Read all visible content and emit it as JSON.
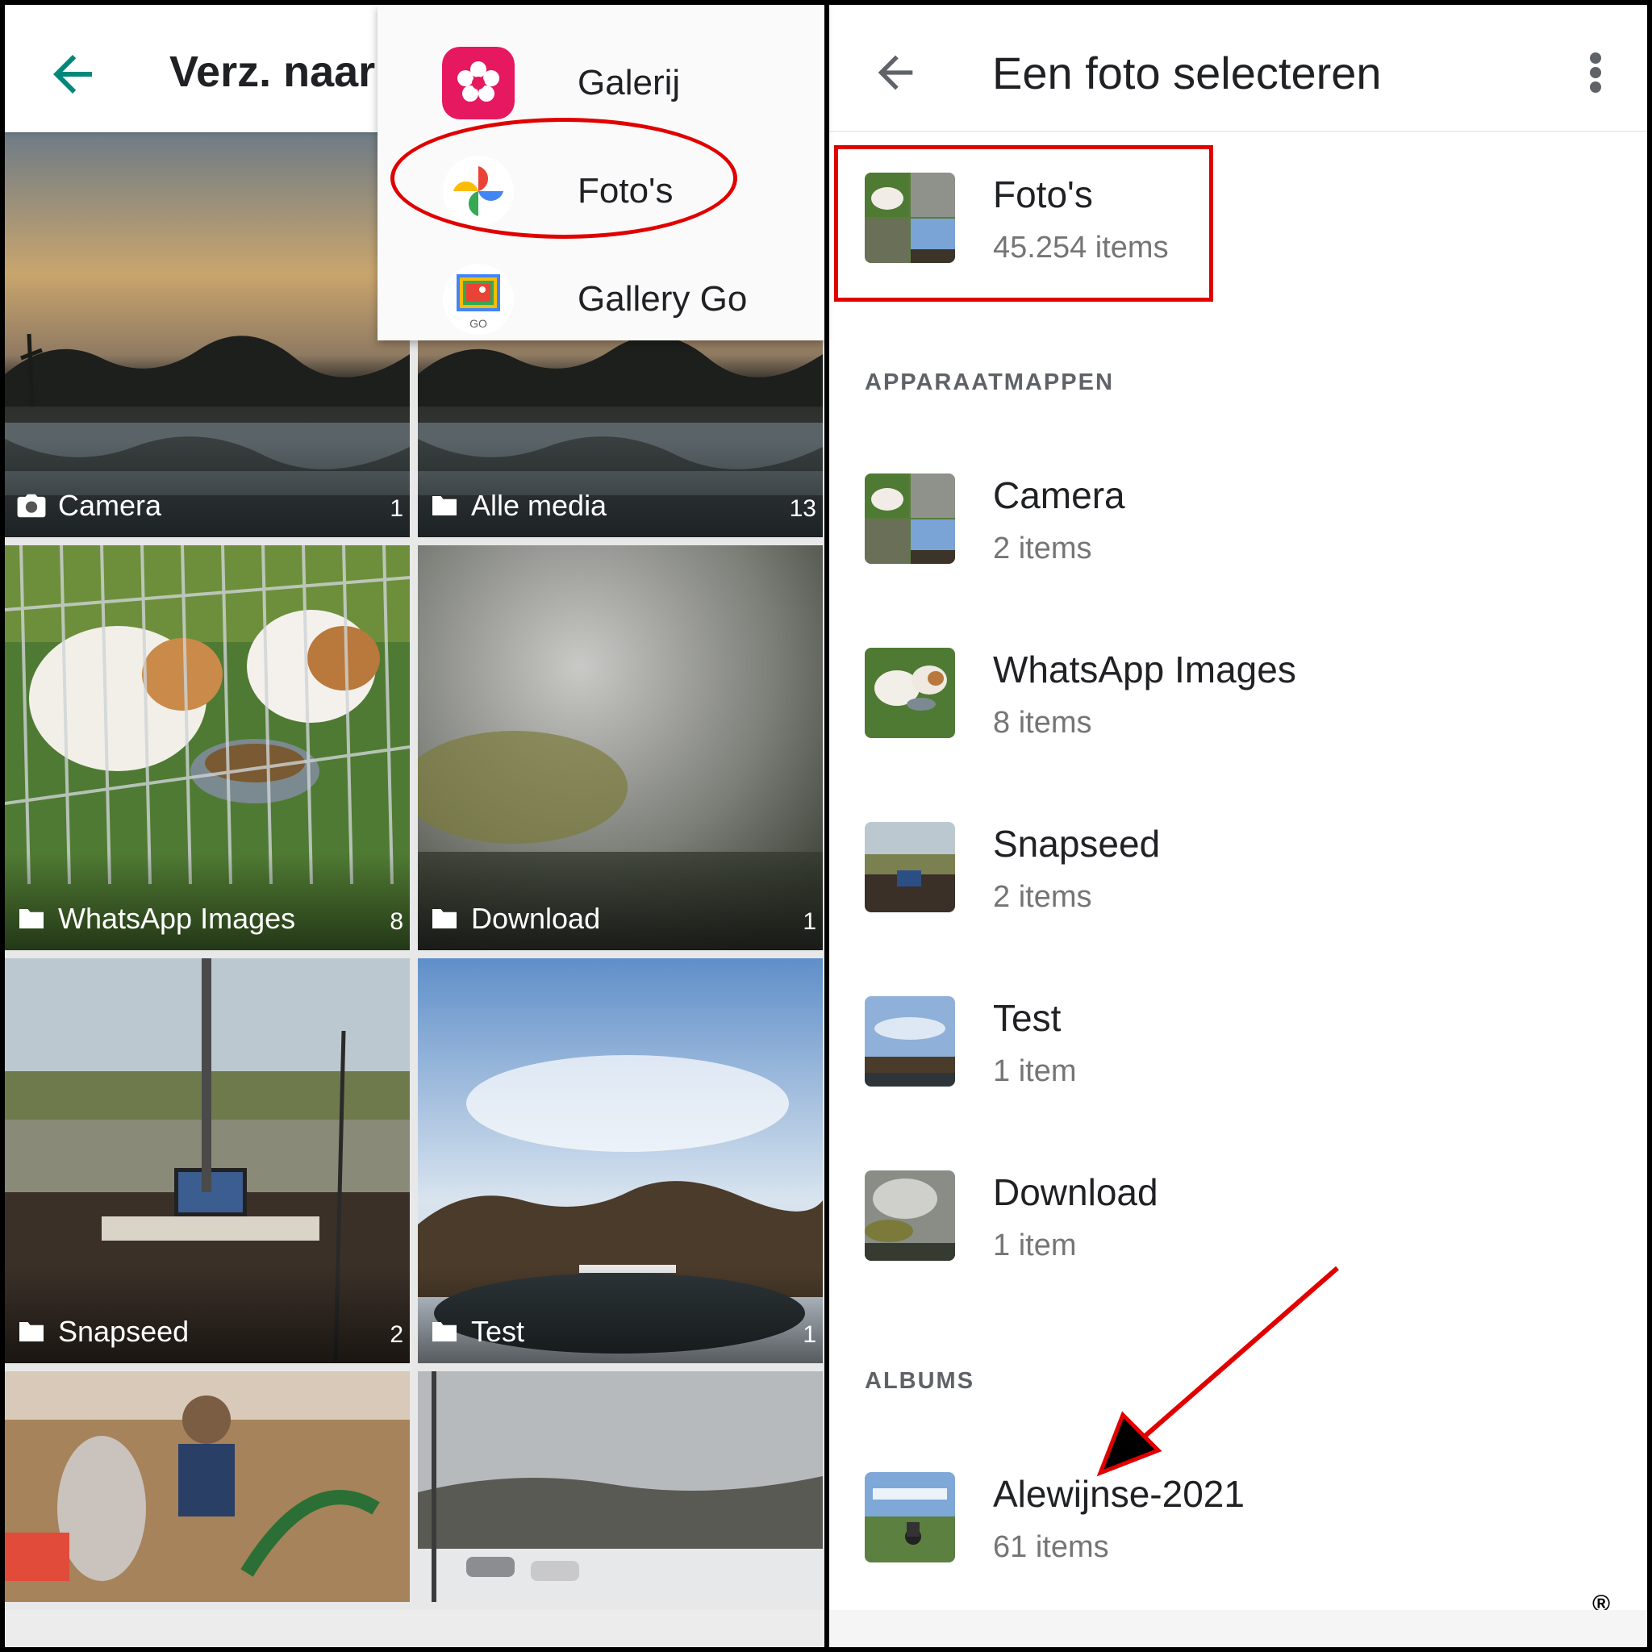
{
  "left": {
    "title": "Verz. naar",
    "tiles": [
      {
        "label": "Camera",
        "count": "1",
        "icon": "camera-icon"
      },
      {
        "label": "Alle media",
        "count": "13",
        "icon": "folder-icon"
      },
      {
        "label": "WhatsApp Images",
        "count": "8",
        "icon": "folder-icon"
      },
      {
        "label": "Download",
        "count": "1",
        "icon": "folder-icon"
      },
      {
        "label": "Snapseed",
        "count": "2",
        "icon": "folder-icon"
      },
      {
        "label": "Test",
        "count": "1",
        "icon": "folder-icon"
      }
    ],
    "menu": [
      {
        "label": "Galerij",
        "icon": "galerij-app-icon"
      },
      {
        "label": "Foto's",
        "icon": "google-photos-icon"
      },
      {
        "label": "Gallery Go",
        "icon": "gallery-go-icon",
        "badge": "GO"
      }
    ]
  },
  "right": {
    "title": "Een foto selecteren",
    "top_item": {
      "name": "Foto's",
      "sub": "45.254 items"
    },
    "section_device": "APPARAATMAPPEN",
    "folders": [
      {
        "name": "Camera",
        "sub": "2 items"
      },
      {
        "name": "WhatsApp Images",
        "sub": "8 items"
      },
      {
        "name": "Snapseed",
        "sub": "2 items"
      },
      {
        "name": "Test",
        "sub": "1 item"
      },
      {
        "name": "Download",
        "sub": "1 item"
      }
    ],
    "section_albums": "ALBUMS",
    "albums": [
      {
        "name": "Alewijnse-2021",
        "sub": "61 items"
      }
    ],
    "registered_mark": "®"
  },
  "colors": {
    "accent": "#00897b",
    "highlight": "#e10000",
    "galerij": "#e91e63"
  }
}
